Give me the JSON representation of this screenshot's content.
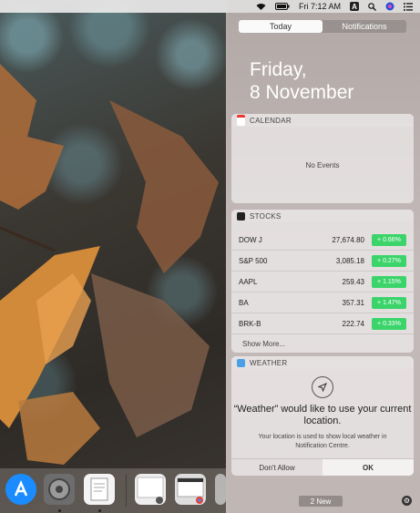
{
  "menubar": {
    "clock": "Fri 7:12 AM",
    "a_label": "A"
  },
  "panel": {
    "tabs": [
      "Today",
      "Notifications"
    ],
    "date_line1": "Friday,",
    "date_line2": "8 November",
    "calendar": {
      "title": "CALENDAR",
      "empty": "No Events"
    },
    "stocks": {
      "title": "STOCKS",
      "rows": [
        {
          "symbol": "DOW J",
          "price": "27,674.80",
          "change": "+ 0.66%"
        },
        {
          "symbol": "S&P 500",
          "price": "3,085.18",
          "change": "+ 0.27%"
        },
        {
          "symbol": "AAPL",
          "price": "259.43",
          "change": "+ 1.15%"
        },
        {
          "symbol": "BA",
          "price": "357.31",
          "change": "+ 1.47%"
        },
        {
          "symbol": "BRK-B",
          "price": "222.74",
          "change": "+ 0.33%"
        }
      ],
      "more": "Show More..."
    },
    "weather": {
      "title": "WEATHER",
      "prompt": "“Weather” would like to use your current location.",
      "desc": "Your location is used to show local weather in Notification Centre.",
      "deny": "Don't Allow",
      "ok": "OK"
    },
    "new_badge": "2 New"
  },
  "colors": {
    "gain": "#3bd46a",
    "accent": "#1a8cff"
  }
}
